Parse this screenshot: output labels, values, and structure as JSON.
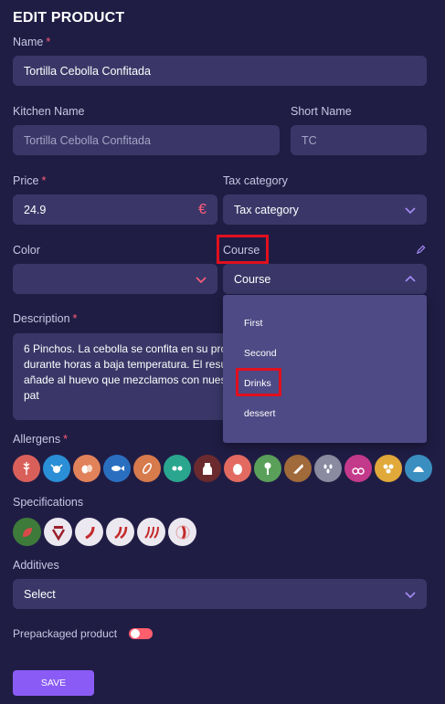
{
  "title": "EDIT PRODUCT",
  "required_mark": "*",
  "name": {
    "label": "Name",
    "value": "Tortilla Cebolla Confitada"
  },
  "kitchen_name": {
    "label": "Kitchen Name",
    "placeholder": "Tortilla Cebolla Confitada"
  },
  "short_name": {
    "label": "Short Name",
    "placeholder": "TC"
  },
  "price": {
    "label": "Price",
    "value": "24.9",
    "currency_symbol": "€"
  },
  "tax_category": {
    "label": "Tax category",
    "value": "Tax category"
  },
  "color": {
    "label": "Color",
    "value": ""
  },
  "course": {
    "label": "Course",
    "value": "Course",
    "options": [
      "First",
      "Second",
      "Drinks",
      "dessert"
    ],
    "highlighted_option": "Drinks"
  },
  "description": {
    "label": "Description",
    "value": "6 Pinchos. La cebolla se confita en su pro\ndurante horas a baja temperatura. El resu\nañade al huevo que mezclamos con nues\npat"
  },
  "allergens": {
    "label": "Allergens",
    "icons": [
      "gluten-icon",
      "crustaceans-icon",
      "eggs-icon",
      "fish-icon",
      "peanuts-icon",
      "soy-icon",
      "milk-icon",
      "nuts-icon",
      "celery-icon",
      "mustard-icon",
      "sesame-icon",
      "sulphites-icon",
      "lupin-icon",
      "molluscs-icon"
    ],
    "colors": [
      "#d9605a",
      "#2a8fd6",
      "#e2825a",
      "#2a6fbf",
      "#d77a4c",
      "#2aa68f",
      "#6b2a2e",
      "#e36a60",
      "#5aa05a",
      "#a06a3a",
      "#8a8aa0",
      "#c43a8a",
      "#e0a93a",
      "#3a8fc0"
    ]
  },
  "specifications": {
    "label": "Specifications",
    "icons": [
      "vegetarian-icon",
      "vegan-icon",
      "spicy-1-icon",
      "spicy-2-icon",
      "spicy-3-icon",
      "spicy-4-icon"
    ]
  },
  "additives": {
    "label": "Additives",
    "value": "Select"
  },
  "prepackaged": {
    "label": "Prepackaged product",
    "enabled": true
  },
  "save_label": "SAVE",
  "colors": {
    "background": "#201d45",
    "field": "#3a3768",
    "accent": "#8a5cf5",
    "required": "#ff5c7a",
    "highlight": "#e0101e"
  }
}
